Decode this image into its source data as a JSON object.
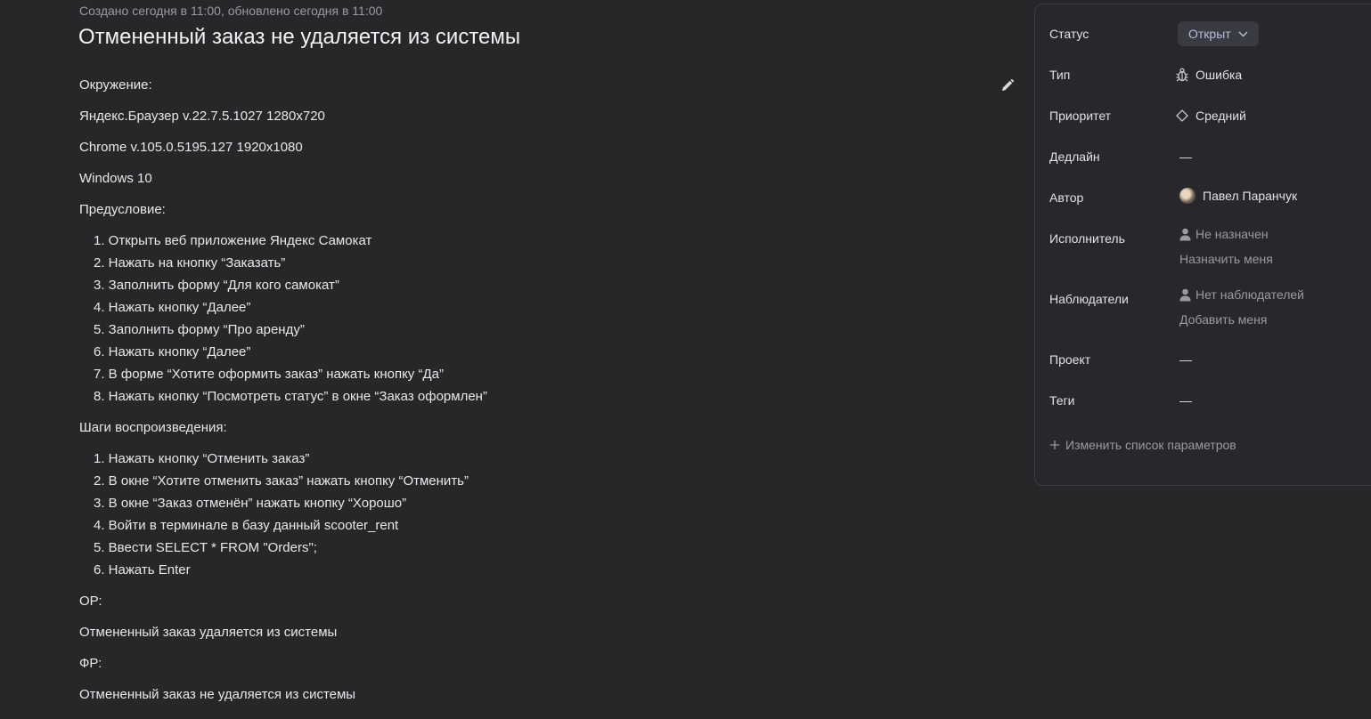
{
  "meta_line": "Создано сегодня в 11:00, обновлено сегодня в 11:00",
  "title": "Отмененный заказ не удаляется из системы",
  "description": {
    "env_heading": "Окружение:",
    "env_lines": [
      "Яндекс.Браузер v.22.7.5.1027 1280x720",
      "Chrome v.105.0.5195.127 1920x1080",
      "Windows 10"
    ],
    "precondition_heading": "Предусловие:",
    "precondition_steps": [
      "1. Открыть веб приложение Яндекс Самокат",
      "2. Нажать на кнопку “Заказать”",
      "3. Заполнить форму “Для кого самокат”",
      "4. Нажать кнопку “Далее”",
      "5. Заполнить форму “Про аренду”",
      "6. Нажать кнопку “Далее”",
      "7. В форме “Хотите оформить заказ” нажать кнопку “Да”",
      "8. Нажать кнопку “Посмотреть статус” в окне “Заказ оформлен”"
    ],
    "steps_heading": "Шаги воспроизведения:",
    "steps": [
      "1. Нажать кнопку “Отменить заказ”",
      "2. В окне “Хотите отменить заказ” нажать кнопку “Отменить”",
      "3. В окне “Заказ отменён” нажать кнопку “Хорошо”",
      "4. Войти в терминале в базу данный scooter_rent",
      "5. Ввести SELECT * FROM \"Orders\";",
      "6. Нажать Enter"
    ],
    "expected_heading": "ОР:",
    "expected": "Отмененный заказ удаляется из системы",
    "actual_heading": "ФР:",
    "actual": "Отмененный заказ не удаляется из системы"
  },
  "panel": {
    "status_label": "Статус",
    "status_value": "Открыт",
    "type_label": "Тип",
    "type_value": "Ошибка",
    "priority_label": "Приоритет",
    "priority_value": "Средний",
    "deadline_label": "Дедлайн",
    "deadline_value": "—",
    "author_label": "Автор",
    "author_value": "Павел Паранчук",
    "assignee_label": "Исполнитель",
    "assignee_value": "Не назначен",
    "assign_me": "Назначить меня",
    "watchers_label": "Наблюдатели",
    "watchers_value": "Нет наблюдателей",
    "add_me": "Добавить меня",
    "project_label": "Проект",
    "project_value": "—",
    "tags_label": "Теги",
    "tags_value": "—",
    "change_params": "Изменить список параметров"
  },
  "colors": {
    "background": "#27272a",
    "text": "#e8e8ea",
    "muted": "#9a9aa1",
    "status_button_bg": "#3a3a42",
    "status_button_text": "#b7bfd8"
  }
}
